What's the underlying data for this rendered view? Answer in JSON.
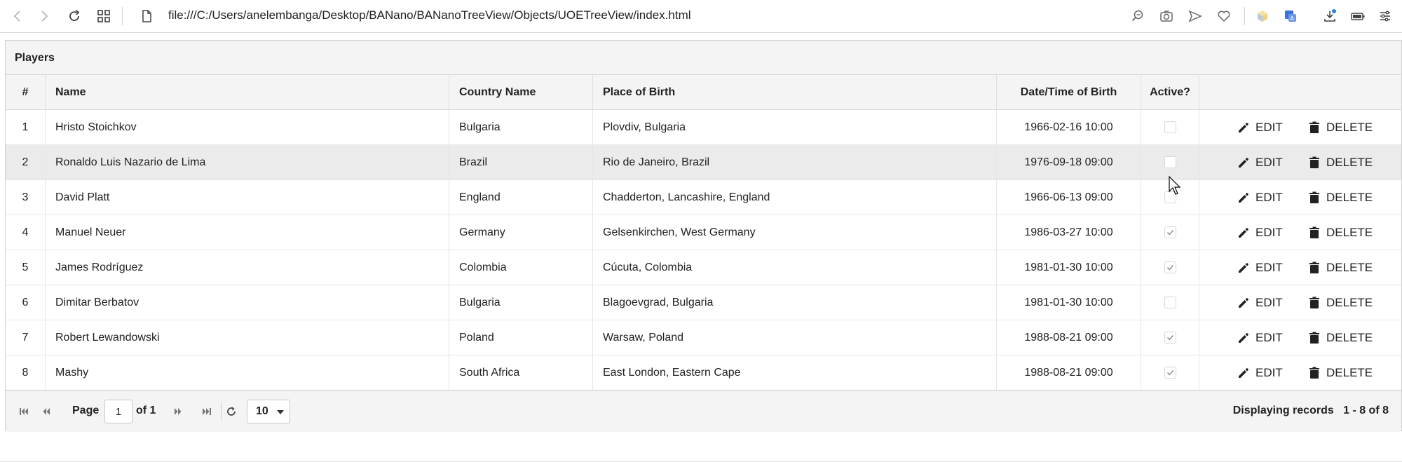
{
  "browser": {
    "url": "file:///C:/Users/anelembanga/Desktop/BANano/BANanoTreeView/Objects/UOETreeView/index.html"
  },
  "grid": {
    "title": "Players",
    "columns": {
      "num": "#",
      "name": "Name",
      "country": "Country Name",
      "place": "Place of Birth",
      "date": "Date/Time of Birth",
      "active": "Active?"
    },
    "edit_label": "EDIT",
    "delete_label": "DELETE",
    "rows": [
      {
        "num": "1",
        "name": "Hristo Stoichkov",
        "country": "Bulgaria",
        "place": "Plovdiv, Bulgaria",
        "date": "1966-02-16 10:00",
        "active": false
      },
      {
        "num": "2",
        "name": "Ronaldo Luis Nazario de Lima",
        "country": "Brazil",
        "place": "Rio de Janeiro, Brazil",
        "date": "1976-09-18 09:00",
        "active": false
      },
      {
        "num": "3",
        "name": "David Platt",
        "country": "England",
        "place": "Chadderton, Lancashire, England",
        "date": "1966-06-13 09:00",
        "active": false
      },
      {
        "num": "4",
        "name": "Manuel Neuer",
        "country": "Germany",
        "place": "Gelsenkirchen, West Germany",
        "date": "1986-03-27 10:00",
        "active": true
      },
      {
        "num": "5",
        "name": "James Rodríguez",
        "country": "Colombia",
        "place": "Cúcuta, Colombia",
        "date": "1981-01-30 10:00",
        "active": true
      },
      {
        "num": "6",
        "name": "Dimitar Berbatov",
        "country": "Bulgaria",
        "place": "Blagoevgrad, Bulgaria",
        "date": "1981-01-30 10:00",
        "active": false
      },
      {
        "num": "7",
        "name": "Robert Lewandowski",
        "country": "Poland",
        "place": "Warsaw, Poland",
        "date": "1988-08-21 09:00",
        "active": true
      },
      {
        "num": "8",
        "name": "Mashy",
        "country": "South Africa",
        "place": "East London, Eastern Cape",
        "date": "1988-08-21 09:00",
        "active": true
      }
    ]
  },
  "pager": {
    "page_label": "Page",
    "page_value": "1",
    "of_label": "of 1",
    "page_size": "10",
    "info": "Displaying records   1 - 8 of 8"
  }
}
